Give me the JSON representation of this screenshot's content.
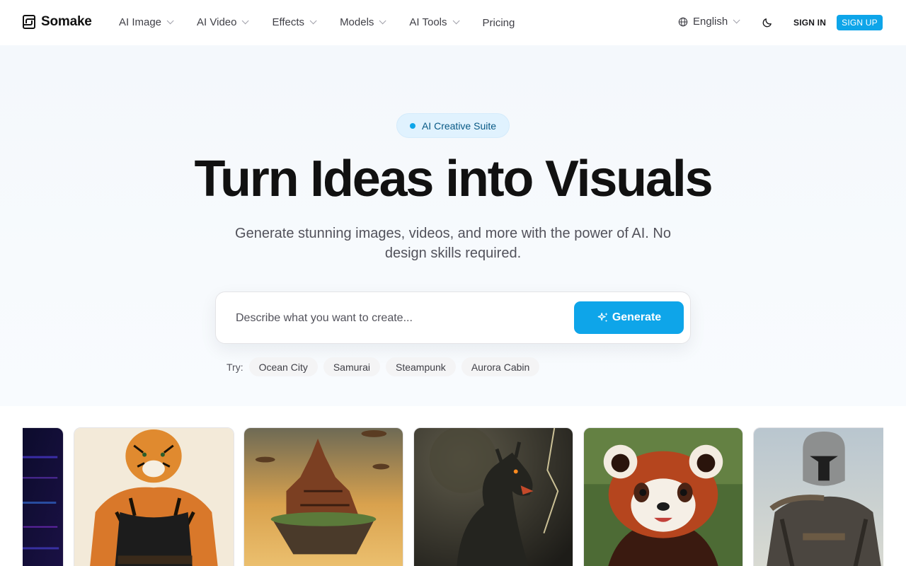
{
  "brand": {
    "name": "Somake"
  },
  "nav": {
    "items": [
      {
        "label": "AI Image"
      },
      {
        "label": "AI Video"
      },
      {
        "label": "Effects"
      },
      {
        "label": "Models"
      },
      {
        "label": "AI Tools"
      }
    ],
    "pricing": "Pricing"
  },
  "header": {
    "language": "English",
    "sign_in": "SIGN IN",
    "sign_up": "SIGN UP"
  },
  "hero": {
    "badge": "AI Creative Suite",
    "title": "Turn Ideas into Visuals",
    "subtitle": "Generate stunning images, videos, and more with the power of AI. No design skills required."
  },
  "prompt": {
    "placeholder": "Describe what you want to create...",
    "value": "",
    "generate_label": "Generate"
  },
  "try": {
    "label": "Try:",
    "suggestions": [
      "Ocean City",
      "Samurai",
      "Steampunk",
      "Aurora Cabin"
    ]
  },
  "gallery": {
    "items": [
      {
        "name": "neon-abstract"
      },
      {
        "name": "tiger-warrior"
      },
      {
        "name": "floating-castle"
      },
      {
        "name": "dragon"
      },
      {
        "name": "red-panda"
      },
      {
        "name": "armored-bounty-hunter"
      }
    ]
  },
  "colors": {
    "accent": "#0ea5e9",
    "badge_bg": "#e0f2fe",
    "text_primary": "#111111",
    "text_muted": "#52525b"
  }
}
